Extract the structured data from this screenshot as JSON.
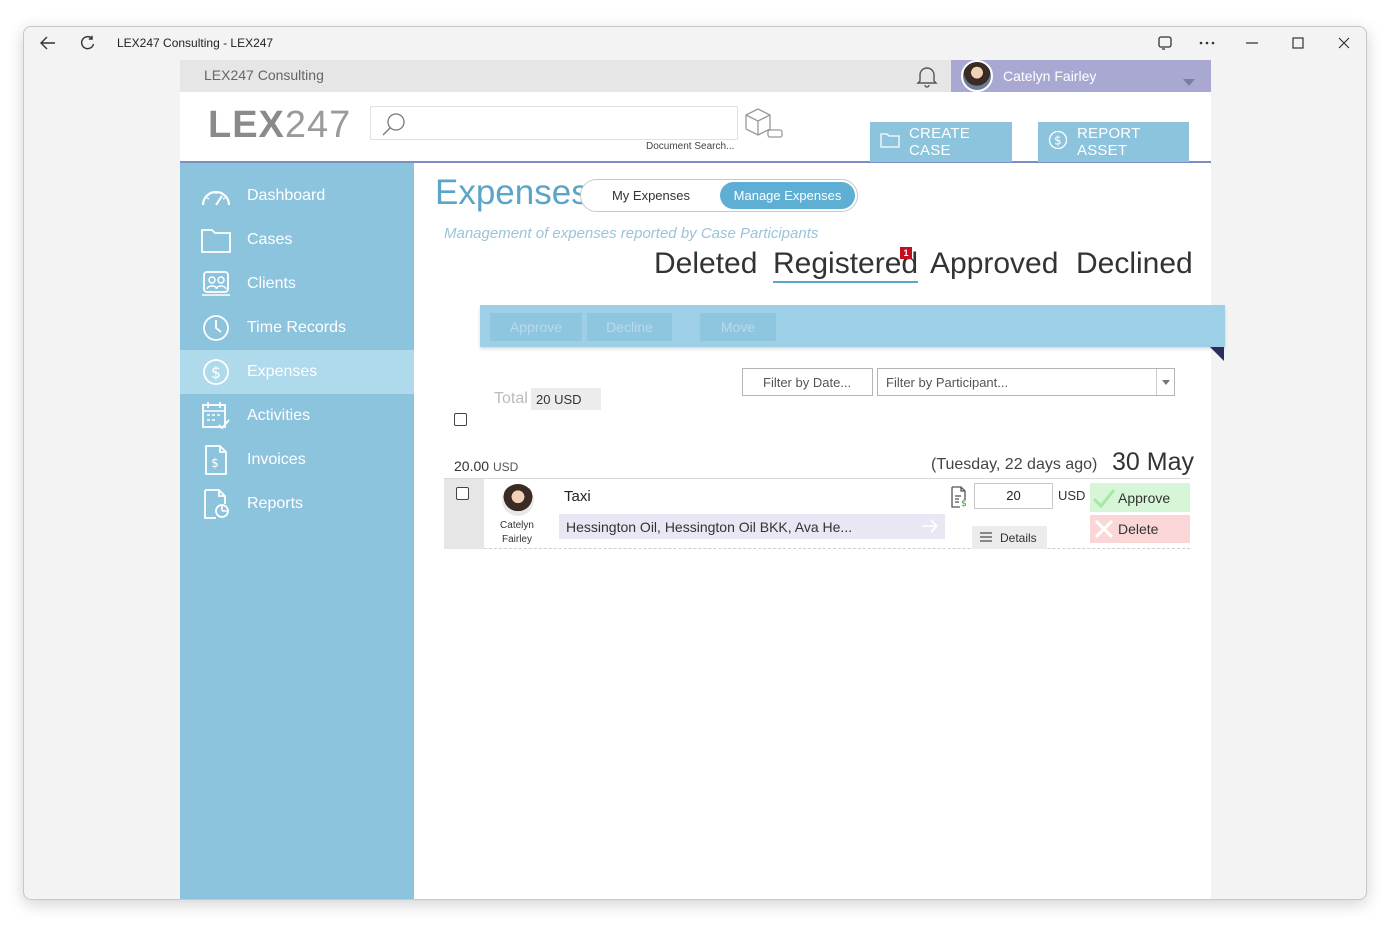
{
  "window": {
    "title": "LEX247 Consulting - LEX247"
  },
  "app": {
    "org_name": "LEX247 Consulting",
    "user_name": "Catelyn Fairley",
    "logo_main": "LEX",
    "logo_suffix": "247",
    "doc_search_label": "Document Search...",
    "create_case_label": "CREATE CASE",
    "report_asset_label": "REPORT ASSET"
  },
  "sidebar": {
    "items": [
      {
        "label": "Dashboard",
        "icon": "gauge-icon"
      },
      {
        "label": "Cases",
        "icon": "folder-icon"
      },
      {
        "label": "Clients",
        "icon": "contacts-icon"
      },
      {
        "label": "Time Records",
        "icon": "clock-icon"
      },
      {
        "label": "Expenses",
        "icon": "dollar-circle-icon",
        "active": true
      },
      {
        "label": "Activities",
        "icon": "calendar-icon"
      },
      {
        "label": "Invoices",
        "icon": "invoice-icon"
      },
      {
        "label": "Reports",
        "icon": "report-icon"
      }
    ]
  },
  "main": {
    "title": "Expenses",
    "toggle": {
      "my": "My Expenses",
      "manage": "Manage Expenses",
      "selected": "Manage Expenses"
    },
    "subtitle": "Management of expenses reported by Case Participants",
    "status_tabs": [
      "Deleted",
      "Registered",
      "Approved",
      "Declined"
    ],
    "active_status": "Registered",
    "registered_badge": "1",
    "actions": {
      "approve": "Approve",
      "decline": "Decline",
      "move": "Move"
    },
    "filters": {
      "date_placeholder": "Filter by Date...",
      "participant_placeholder": "Filter by Participant..."
    },
    "total_label": "Total",
    "total_value": "20 USD",
    "group": {
      "amount": "20.00",
      "currency": "USD",
      "relative": "(Tuesday, 22 days ago)",
      "date": "30 May"
    },
    "expense": {
      "owner_first": "Catelyn",
      "owner_last": "Fairley",
      "title": "Taxi",
      "case": "Hessington Oil, Hessington Oil BKK, Ava He...",
      "quantity": "20",
      "currency": "USD",
      "details_label": "Details",
      "approve_label": "Approve",
      "delete_label": "Delete"
    }
  },
  "colors": {
    "accent": "#8cc3dd",
    "title": "#5aa5c8",
    "badge": "#c0101f",
    "userbar": "#a9a8d2"
  }
}
